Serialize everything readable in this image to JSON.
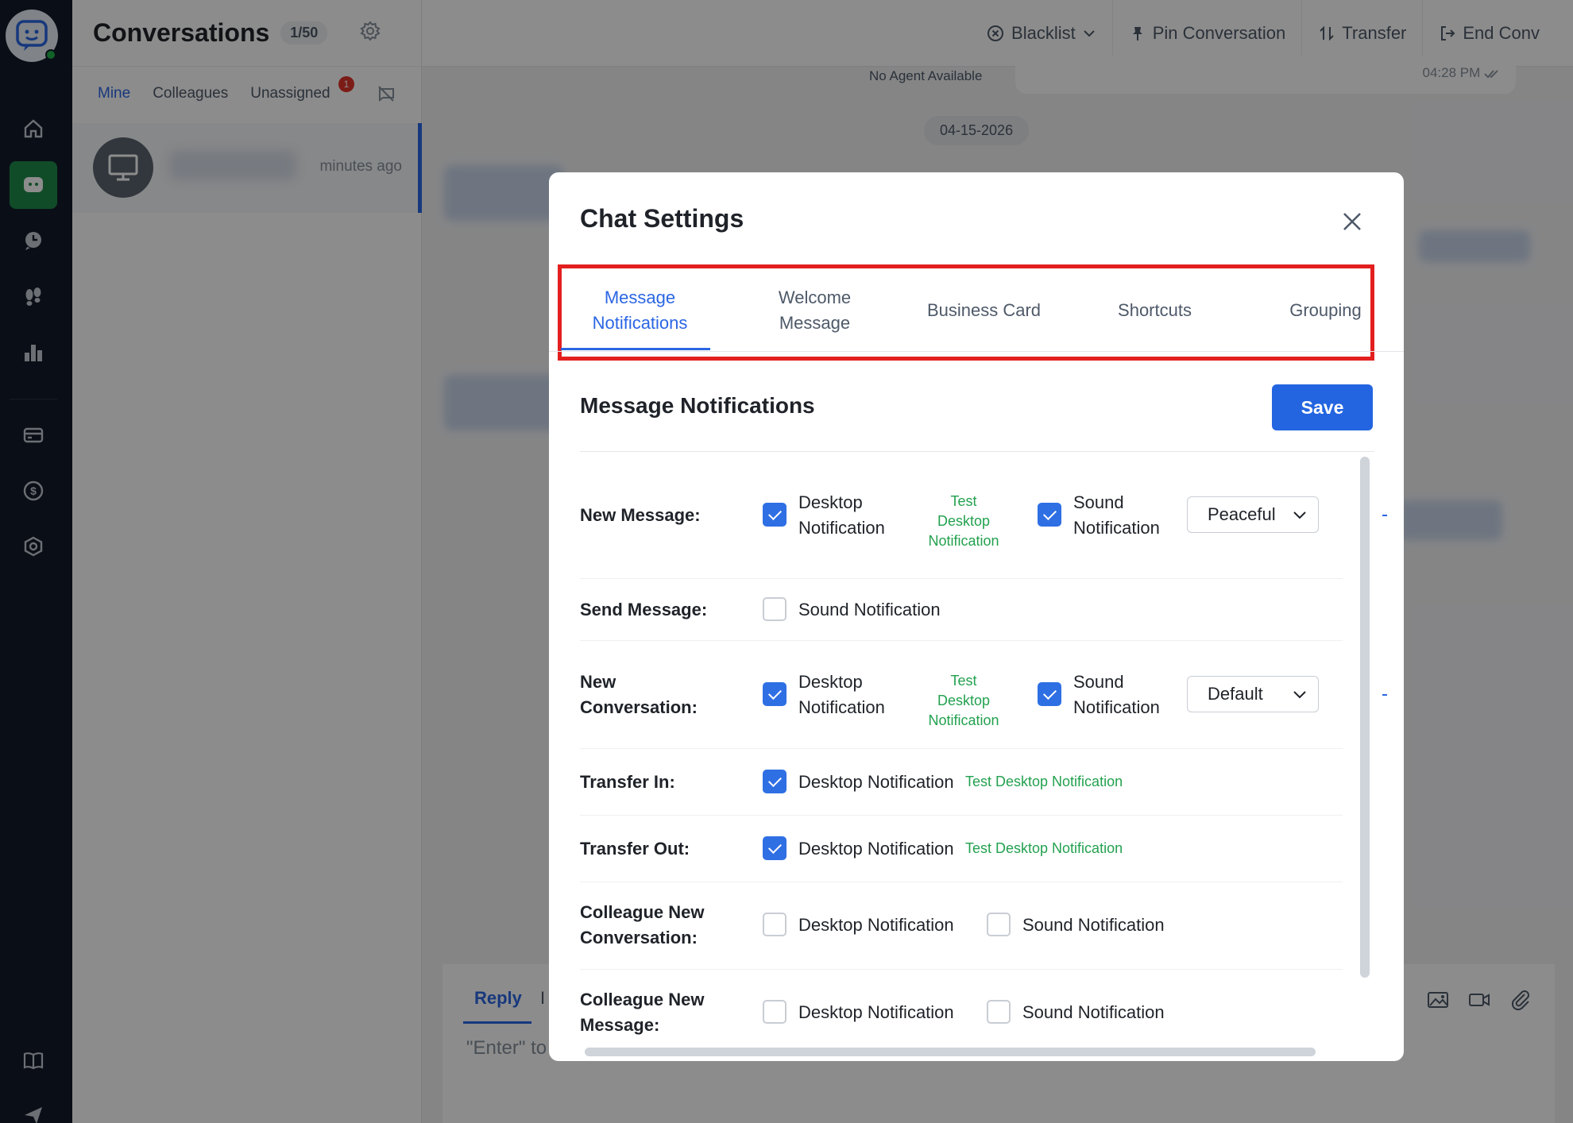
{
  "conversations": {
    "title": "Conversations",
    "count": "1/50",
    "tabs": [
      "Mine",
      "Colleagues",
      "Unassigned"
    ],
    "unassigned_badge": "1",
    "item_time": "minutes ago"
  },
  "topbar": {
    "blacklist": "Blacklist",
    "pin": "Pin Conversation",
    "transfer": "Transfer",
    "end": "End Conv"
  },
  "chat": {
    "no_agent": "No Agent Available",
    "msg_time": "04:28 PM",
    "date_chip": "04-15-2026",
    "reply_tab": "Reply",
    "reply_tab2": "I",
    "reply_placeholder": "\"Enter\" to"
  },
  "modal": {
    "title": "Chat Settings",
    "tabs": [
      {
        "line1": "Message",
        "line2": "Notifications"
      },
      {
        "line1": "Welcome",
        "line2": "Message"
      },
      {
        "line1": "Business Card",
        "line2": ""
      },
      {
        "line1": "Shortcuts",
        "line2": ""
      },
      {
        "line1": "Grouping",
        "line2": ""
      }
    ],
    "section_title": "Message Notifications",
    "save": "Save",
    "rows": {
      "new_message": {
        "label": "New Message:",
        "desktop_l1": "Desktop",
        "desktop_l2": "Notification",
        "test_l1": "Test",
        "test_l2": "Desktop",
        "test_l3": "Notification",
        "sound_l1": "Sound",
        "sound_l2": "Notification",
        "select": "Peaceful",
        "desktop_checked": true,
        "sound_checked": true
      },
      "send_message": {
        "label": "Send Message:",
        "sound": "Sound Notification",
        "sound_checked": false
      },
      "new_conversation": {
        "label_l1": "New",
        "label_l2": "Conversation:",
        "desktop_l1": "Desktop",
        "desktop_l2": "Notification",
        "test_l1": "Test",
        "test_l2": "Desktop",
        "test_l3": "Notification",
        "sound_l1": "Sound",
        "sound_l2": "Notification",
        "select": "Default",
        "desktop_checked": true,
        "sound_checked": true
      },
      "transfer_in": {
        "label": "Transfer In:",
        "desktop": "Desktop Notification",
        "test": "Test Desktop Notification",
        "desktop_checked": true
      },
      "transfer_out": {
        "label": "Transfer Out:",
        "desktop": "Desktop Notification",
        "test": "Test Desktop Notification",
        "desktop_checked": true
      },
      "colleague_new_conversation": {
        "label_l1": "Colleague New",
        "label_l2": "Conversation:",
        "desktop": "Desktop Notification",
        "sound": "Sound Notification",
        "desktop_checked": false,
        "sound_checked": false
      },
      "colleague_new_message": {
        "label_l1": "Colleague New",
        "label_l2": "Message:",
        "desktop": "Desktop Notification",
        "sound": "Sound Notification",
        "desktop_checked": false,
        "sound_checked": false
      }
    }
  },
  "colors": {
    "accent": "#2b66e3",
    "save": "#2365e0",
    "highlight": "#e31f1f",
    "test_link": "#23a14f",
    "nav_bg": "#131c2b",
    "nav_active": "#1f8a4c"
  },
  "icons": [
    "home-icon",
    "chat-icon",
    "history-icon",
    "footprints-icon",
    "bar-chart-icon",
    "card-icon",
    "dollar-icon",
    "settings-hex-icon",
    "book-icon",
    "send-icon",
    "gear-icon",
    "close-icon",
    "pin-icon",
    "transfer-icon",
    "exit-icon",
    "image-icon",
    "video-icon",
    "paperclip-icon",
    "monitor-icon",
    "read-check-icon",
    "chevron-down-icon"
  ]
}
